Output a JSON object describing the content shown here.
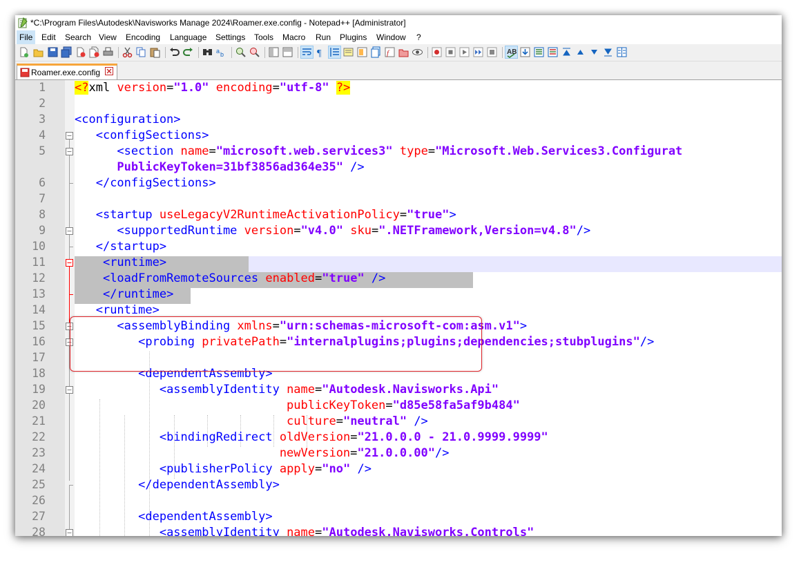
{
  "window": {
    "title": "*C:\\Program Files\\Autodesk\\Navisworks Manage 2024\\Roamer.exe.config - Notepad++ [Administrator]"
  },
  "menu": [
    "File",
    "Edit",
    "Search",
    "View",
    "Encoding",
    "Language",
    "Settings",
    "Tools",
    "Macro",
    "Run",
    "Plugins",
    "Window",
    "?"
  ],
  "tab": {
    "label": "Roamer.exe.config"
  },
  "line_numbers": [
    "1",
    "2",
    "3",
    "4",
    "5",
    "",
    "6",
    "7",
    "8",
    "9",
    "10",
    "11",
    "12",
    "13",
    "14",
    "15",
    "16",
    "17",
    "18",
    "19",
    "20",
    "21",
    "22",
    "23",
    "24",
    "25",
    "26",
    "27",
    "28"
  ],
  "code": {
    "l1": {
      "open": "<?",
      "xml": "xml",
      "a1": " version",
      "eq1": "=",
      "v1": "\"1.0\"",
      "a2": " encoding",
      "eq2": "=",
      "v2": "\"utf-8\"",
      "sp": " ",
      "close": "?>"
    },
    "l3": {
      "tag": "<configuration>"
    },
    "l4": {
      "tag": "<configSections>"
    },
    "l5": {
      "tag": "<section",
      "a1": " name",
      "eq1": "=",
      "v1": "\"microsoft.web.services3\"",
      "a2": " type",
      "eq2": "=",
      "v2": "\"Microsoft.Web.Services3.Configurat"
    },
    "l5b": {
      "v": "PublicKeyToken=31bf3856ad364e35\"",
      "end": " />"
    },
    "l6": {
      "tag": "</configSections>"
    },
    "l8": {
      "tag": "<startup",
      "a1": " useLegacyV2RuntimeActivationPolicy",
      "eq1": "=",
      "v1": "\"true\"",
      "end": ">"
    },
    "l9": {
      "tag": "<supportedRuntime",
      "a1": " version",
      "eq1": "=",
      "v1": "\"v4.0\"",
      "a2": " sku",
      "eq2": "=",
      "v2": "\".NETFramework,Version=v4.8\"",
      "end": "/>"
    },
    "l10": {
      "tag": "</startup>"
    },
    "l11": {
      "tag": "<runtime>"
    },
    "l12": {
      "tag": "<loadFromRemoteSources",
      "a1": " enabled",
      "eq1": "=",
      "v1": "\"true\"",
      "end": " />"
    },
    "l13": {
      "tag": "</runtime>"
    },
    "l14": {
      "tag": "<runtime>"
    },
    "l15": {
      "tag": "<assemblyBinding",
      "a1": " xmlns",
      "eq1": "=",
      "v1": "\"urn:schemas-microsoft-com:asm.v1\"",
      "end": ">"
    },
    "l16": {
      "tag": "<probing",
      "a1": " privatePath",
      "eq1": "=",
      "v1": "\"internalplugins;plugins;dependencies;stubplugins\"",
      "end": "/>"
    },
    "l18": {
      "tag": "<dependentAssembly>"
    },
    "l19": {
      "tag": "<assemblyIdentity",
      "a1": " name",
      "eq1": "=",
      "v1": "\"Autodesk.Navisworks.Api\""
    },
    "l20": {
      "a1": "publicKeyToken",
      "eq1": "=",
      "v1": "\"d85e58fa5af9b484\""
    },
    "l21": {
      "a1": "culture",
      "eq1": "=",
      "v1": "\"neutral\"",
      "end": " />"
    },
    "l22": {
      "tag": "<bindingRedirect",
      "a1": " oldVersion",
      "eq1": "=",
      "v1": "\"21.0.0.0 - 21.0.9999.9999\""
    },
    "l23": {
      "a1": "newVersion",
      "eq1": "=",
      "v1": "\"21.0.0.00\"",
      "end": "/>"
    },
    "l24": {
      "tag": "<publisherPolicy",
      "a1": " apply",
      "eq1": "=",
      "v1": "\"no\"",
      "end": " />"
    },
    "l25": {
      "tag": "</dependentAssembly>"
    },
    "l27": {
      "tag": "<dependentAssembly>"
    },
    "l28": {
      "tag": "<assemblyIdentity",
      "a1": " name",
      "eq1": "=",
      "v1": "\"Autodesk.Navisworks.Controls\""
    }
  },
  "colors": {
    "tag": "#0000ff",
    "attr": "#ff0000",
    "value": "#8000ff",
    "annotation": "#e0242a",
    "tab_accent": "#f7a53b"
  }
}
